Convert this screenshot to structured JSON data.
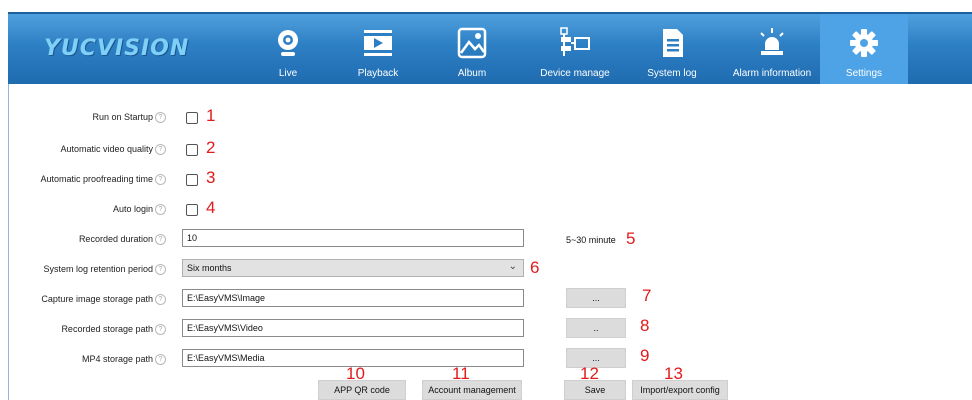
{
  "app": {
    "logo": "YUCVISION"
  },
  "nav": [
    {
      "id": "live",
      "label": "Live",
      "icon": "webcam-icon"
    },
    {
      "id": "playback",
      "label": "Playback",
      "icon": "film-play-icon"
    },
    {
      "id": "album",
      "label": "Album",
      "icon": "image-icon"
    },
    {
      "id": "device",
      "label": "Device manage",
      "icon": "device-tree-icon"
    },
    {
      "id": "syslog",
      "label": "System log",
      "icon": "document-icon"
    },
    {
      "id": "alarm",
      "label": "Alarm information",
      "icon": "alarm-light-icon"
    },
    {
      "id": "settings",
      "label": "Settings",
      "icon": "gear-icon",
      "active": true
    }
  ],
  "settings": {
    "run_on_startup": {
      "label": "Run on Startup",
      "checked": false,
      "marker": "1"
    },
    "auto_video_quality": {
      "label": "Automatic video quality",
      "checked": false,
      "marker": "2"
    },
    "auto_proofreading": {
      "label": "Automatic proofreading time",
      "checked": false,
      "marker": "3"
    },
    "auto_login": {
      "label": "Auto login",
      "checked": false,
      "marker": "4"
    },
    "recorded_duration": {
      "label": "Recorded duration",
      "value": "10",
      "unit": "5~30 minute",
      "marker": "5"
    },
    "log_retention": {
      "label": "System log retention period",
      "selected": "Six months",
      "marker": "6"
    },
    "capture_path": {
      "label": "Capture image storage path",
      "value": "E:\\EasyVMS\\Image",
      "browse": "...",
      "marker": "7"
    },
    "recorded_path": {
      "label": "Recorded storage path",
      "value": "E:\\EasyVMS\\Video",
      "browse": "..",
      "marker": "8"
    },
    "mp4_path": {
      "label": "MP4 storage path",
      "value": "E:\\EasyVMS\\Media",
      "browse": "...",
      "marker": "9"
    }
  },
  "actions": {
    "qr": {
      "label": "APP QR code",
      "marker": "10"
    },
    "account": {
      "label": "Account management",
      "marker": "11"
    },
    "save": {
      "label": "Save",
      "marker": "12"
    },
    "import_export": {
      "label": "Import/export config",
      "marker": "13"
    }
  },
  "colors": {
    "header": "#2d7fc4",
    "active_tab": "#4ea3e6",
    "marker": "#e11b1b"
  }
}
